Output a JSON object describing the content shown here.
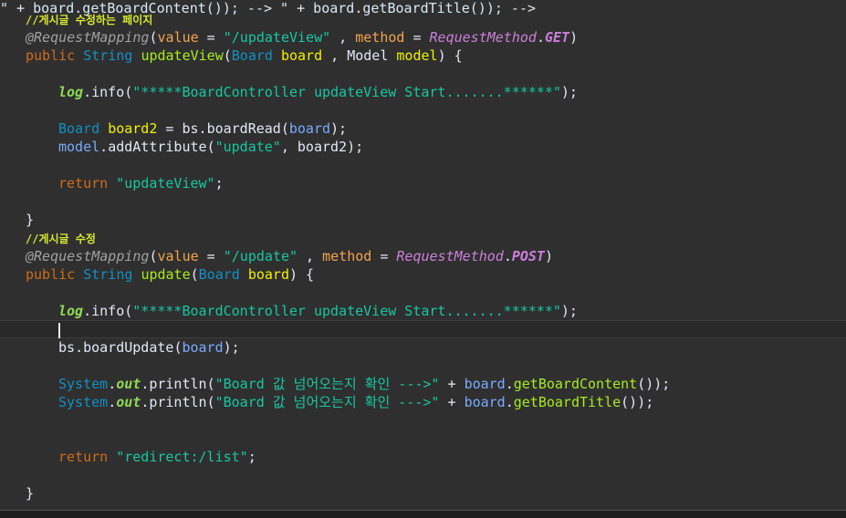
{
  "editor": {
    "comment1": "//게시글 수정하는 페이지",
    "comment2": "//게시글 수정",
    "tokens": {
      "at_request_mapping": "@RequestMapping",
      "value_param": "value",
      "method_param": "method",
      "request_method": "RequestMethod",
      "get": "GET",
      "post": "POST",
      "public": "public",
      "string_type": "String",
      "board_type": "Board",
      "model_type": "Model",
      "return": "return",
      "system": "System",
      "out": "out",
      "log": "log"
    },
    "lines": {
      "l1_path": "\"/updateView\"",
      "l2_method": "updateView",
      "l2_p1": "board",
      "l2_p2": "model",
      "l3_info": "info",
      "l3_str": "\"*****BoardController updateView Start.......******\"",
      "l4_var": "board2",
      "l4_obj": "bs",
      "l4_call": "boardRead",
      "l4_arg": "board",
      "l5_obj": "model",
      "l5_call": "addAttribute",
      "l5_str": "\"update\"",
      "l5_arg": "board2",
      "l6_str": "\"updateView\"",
      "l7_path": "\"/update\"",
      "l8_method": "update",
      "l8_p1": "board",
      "l9_str": "\"*****BoardController updateView Start.......******\"",
      "l10_obj": "bs",
      "l10_call": "boardUpdate",
      "l10_arg": "board",
      "l11_println": "println",
      "l11_str": "\"Board 값 넘어오는지 확인 --->\"",
      "l11_obj": "board",
      "l11_call": "getBoardContent",
      "l12_str": "\"Board 값 넘어오는지 확인 --->\"",
      "l12_call": "getBoardTitle",
      "l13_str": "\"redirect:/list\""
    }
  }
}
